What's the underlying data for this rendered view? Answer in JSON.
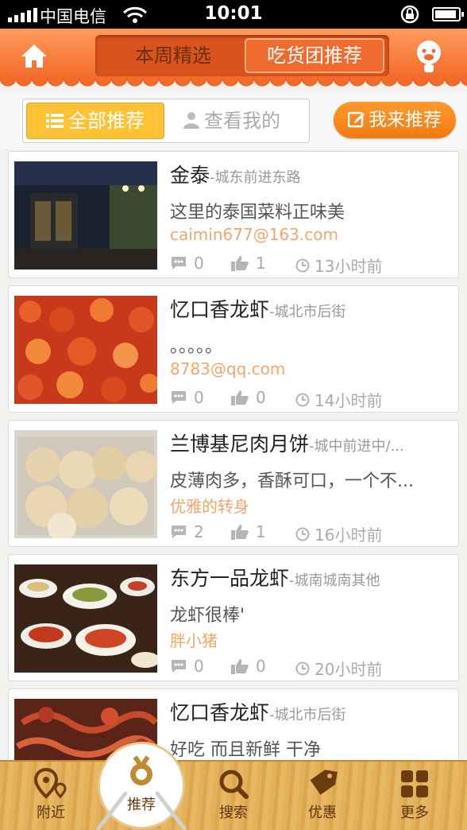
{
  "status_bar": {
    "carrier": "中国电信",
    "time": "10:01"
  },
  "header": {
    "tab_weekly": "本周精选",
    "tab_foodie": "吃货团推荐"
  },
  "filter": {
    "tab_all": "全部推荐",
    "tab_mine": "查看我的",
    "recommend_button": "我来推荐"
  },
  "feed": [
    {
      "name": "金泰",
      "location": "-城东前进东路",
      "description": "这里的泰国菜料正味美",
      "author": "caimin677@163.com",
      "comments": "0",
      "likes": "1",
      "time": "13小时前"
    },
    {
      "name": "忆口香龙虾",
      "location": "-城北市后街",
      "description": "。。。。。",
      "author": "8783@qq.com",
      "comments": "0",
      "likes": "0",
      "time": "14小时前"
    },
    {
      "name": "兰博基尼肉月饼",
      "location": "-城中前进中/...",
      "description": "皮薄肉多，香酥可口，一个不...",
      "author": "优雅的转身",
      "comments": "2",
      "likes": "1",
      "time": "16小时前"
    },
    {
      "name": "东方一品龙虾",
      "location": "-城南城南其他",
      "description": "龙虾很棒'",
      "author": "胖小猪",
      "comments": "0",
      "likes": "0",
      "time": "20小时前"
    },
    {
      "name": "忆口香龙虾",
      "location": "-城北市后街",
      "description": "好吃  而且新鲜  干净",
      "author": "",
      "comments": "",
      "likes": "",
      "time": ""
    }
  ],
  "tabbar": {
    "nearby": "附近",
    "recommend": "推荐",
    "search": "搜索",
    "deals": "优惠",
    "more": "更多"
  },
  "colors": {
    "header_orange": "#f36a2a",
    "accent_orange": "#f27a10",
    "tab_yellow": "#ffc234",
    "author_text": "#f4a66a"
  }
}
